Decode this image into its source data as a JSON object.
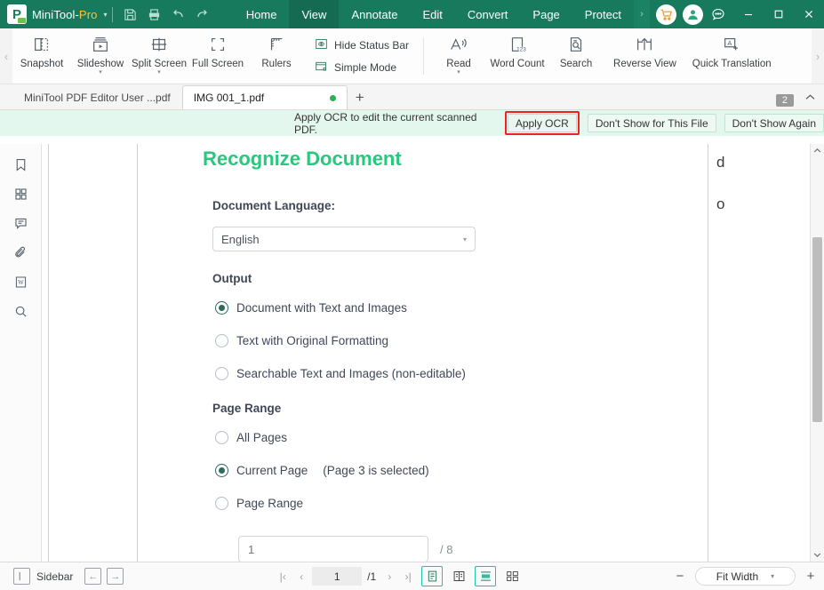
{
  "titlebar": {
    "brand_main": "MiniTool",
    "brand_sep": "-",
    "brand_pro": "Pro",
    "dropdown_caret": "▾",
    "icons": [
      "save-icon",
      "print-icon",
      "undo-icon",
      "redo-icon"
    ],
    "menu_tabs": [
      {
        "label": "Home",
        "active": false
      },
      {
        "label": "View",
        "active": true
      },
      {
        "label": "Annotate",
        "active": false
      },
      {
        "label": "Edit",
        "active": false
      },
      {
        "label": "Convert",
        "active": false
      },
      {
        "label": "Page",
        "active": false
      },
      {
        "label": "Protect",
        "active": false
      }
    ],
    "more_tabs": "›",
    "cart_icon": "shopping-cart-icon",
    "account_icon": "user-account-icon",
    "feedback_icon": "feedback-bubble-icon",
    "minimize": "—",
    "maximize": "☐",
    "close": "✕"
  },
  "ribbon": {
    "collapse_left": "‹",
    "expand_right": "›",
    "view_items": [
      {
        "label": "Snapshot",
        "icon": "snapshot-icon",
        "dropdown": false
      },
      {
        "label": "Slideshow",
        "icon": "slideshow-icon",
        "dropdown": true
      },
      {
        "label": "Split Screen",
        "icon": "split-screen-icon",
        "dropdown": true
      },
      {
        "label": "Full Screen",
        "icon": "full-screen-icon",
        "dropdown": false
      },
      {
        "label": "Rulers",
        "icon": "rulers-icon",
        "dropdown": false
      }
    ],
    "toggles": [
      {
        "label": "Hide Status Bar",
        "icon": "hide-status-bar-icon"
      },
      {
        "label": "Simple Mode",
        "icon": "simple-mode-icon"
      }
    ],
    "tools": [
      {
        "label": "Read",
        "icon": "read-aloud-icon",
        "dropdown": true
      },
      {
        "label": "Word Count",
        "icon": "word-count-icon",
        "dropdown": false
      },
      {
        "label": "Search",
        "icon": "search-document-icon",
        "dropdown": false
      },
      {
        "label": "Reverse View",
        "icon": "reverse-view-icon",
        "dropdown": false
      },
      {
        "label": "Quick Translation",
        "icon": "quick-translation-icon",
        "dropdown": false
      }
    ]
  },
  "tabbar": {
    "tabs": [
      {
        "label": "MiniTool PDF Editor User ...pdf",
        "active": false,
        "modified": false
      },
      {
        "label": "IMG 001_1.pdf",
        "active": true,
        "modified": true
      }
    ],
    "new_tab": "+",
    "tab_count": "2",
    "collapse_icon": "chevron-up-icon"
  },
  "notification": {
    "message": "Apply OCR to edit the current scanned PDF.",
    "primary_button": "Apply OCR",
    "secondary_button": "Don't Show for This File",
    "tertiary_button": "Don't Show Again",
    "highlight_color": "#ee2222",
    "background_color": "#e4f7ee"
  },
  "leftrail": {
    "items": [
      {
        "icon": "bookmark-icon",
        "name": "bookmarks"
      },
      {
        "icon": "thumbnails-grid-icon",
        "name": "thumbnails"
      },
      {
        "icon": "comment-icon",
        "name": "comments"
      },
      {
        "icon": "attachment-paperclip-icon",
        "name": "attachments"
      },
      {
        "icon": "watermark-w-icon",
        "name": "watermark"
      },
      {
        "icon": "search-magnifier-icon",
        "name": "search"
      }
    ]
  },
  "ocr_panel": {
    "title": "Recognize Document",
    "title_color": "#28c87e",
    "language_label": "Document Language:",
    "language_value": "English",
    "language_caret": "▾",
    "output_label": "Output",
    "output_options": [
      {
        "label": "Document with Text and Images",
        "selected": true
      },
      {
        "label": "Text with Original Formatting",
        "selected": false
      },
      {
        "label": "Searchable Text and Images (non-editable)",
        "selected": false
      }
    ],
    "page_range_label": "Page Range",
    "page_range_options": [
      {
        "label": "All Pages",
        "selected": false,
        "note": ""
      },
      {
        "label": "Current Page",
        "selected": true,
        "note": "(Page 3 is selected)"
      },
      {
        "label": "Page Range",
        "selected": false,
        "note": ""
      }
    ],
    "range_input_value": "1",
    "range_total": "/ 8"
  },
  "page_preview": {
    "cut_letter_top": "d",
    "cut_letter_bottom": "o"
  },
  "statusbar": {
    "sidebar_label": "Sidebar",
    "sidebar_toggle_icon": "sidebar-panel-icon",
    "prev_pane_icon": "←",
    "next_pane_icon": "→",
    "first_page_icon": "|‹",
    "prev_page_icon": "‹",
    "current_page": "1",
    "total_pages": "/1",
    "next_page_icon": "›",
    "last_page_icon": "›|",
    "view_modes": [
      {
        "icon": "single-page-view-icon",
        "selected": true
      },
      {
        "icon": "two-page-view-icon",
        "selected": false
      },
      {
        "icon": "continuous-scroll-icon",
        "selected": true
      },
      {
        "icon": "facing-pages-icon",
        "selected": false
      }
    ],
    "zoom_out": "−",
    "zoom_value": "Fit Width",
    "zoom_caret": "▾",
    "zoom_in": "+"
  }
}
